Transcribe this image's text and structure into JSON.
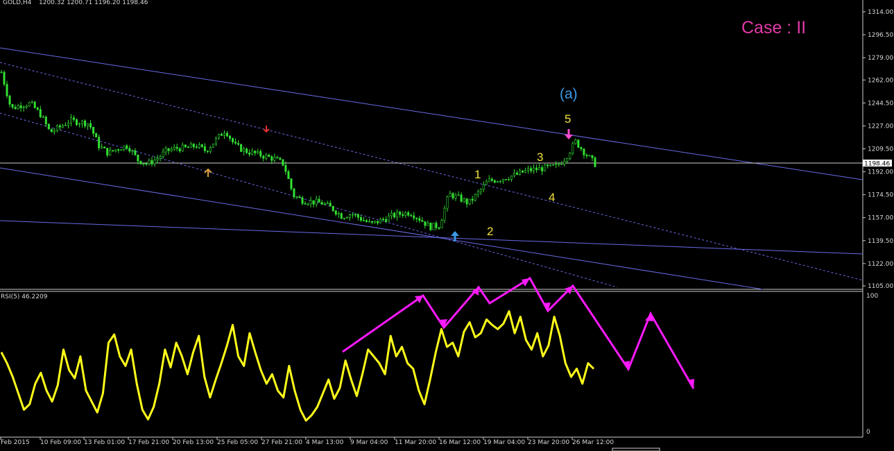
{
  "header": {
    "symbol": "GOLD,H4",
    "ohlc": "1200.32 1200.71 1196.20 1198.46"
  },
  "annotations": {
    "case_label": "Case : II",
    "wave_a": "(a)",
    "wave_numbers": [
      "1",
      "2",
      "3",
      "4",
      "5"
    ]
  },
  "indicator": {
    "label": "RSI(5) 46.2209",
    "max_label": "100",
    "min_label": "0"
  },
  "colors": {
    "background": "#000000",
    "candle": "#33e033",
    "rsi_line": "#ffff1a",
    "channel": "#6a6ae8",
    "projection": "#ff1aff",
    "wave_text": "#f2e23a",
    "case_text": "#e23aa8",
    "wave_a_text": "#3a9ae8"
  },
  "chart_data": [
    {
      "type": "candlestick",
      "symbol": "GOLD",
      "timeframe": "H4",
      "current_price": 1198.46,
      "ylim": [
        1105,
        1314
      ],
      "y_ticks": [
        1314.0,
        1296.5,
        1279.0,
        1262.0,
        1244.5,
        1227.0,
        1209.5,
        1192.0,
        1174.5,
        1157.0,
        1139.5,
        1122.0,
        1105.0
      ],
      "y_tick_labels": [
        "1314.00",
        "1296.50",
        "1279.00",
        "1262.00",
        "1244.50",
        "1227.00",
        "1209.50",
        "1192.00",
        "1174.50",
        "1157.00",
        "1139.50",
        "1122.00",
        "1105.00"
      ],
      "price_label": "1198.46",
      "x_tick_labels": [
        "Feb 2015",
        "10 Feb 09:00",
        "13 Feb 01:00",
        "17 Feb 21:00",
        "20 Feb 13:00",
        "25 Feb 05:00",
        "27 Feb 21:00",
        "4 Mar 13:00",
        "9 Mar 04:00",
        "11 Mar 20:00",
        "16 Mar 12:00",
        "19 Mar 04:00",
        "23 Mar 20:00",
        "26 Mar 12:00"
      ],
      "close_path": [
        1268,
        1240,
        1243,
        1244,
        1236,
        1222,
        1226,
        1231,
        1230,
        1229,
        1212,
        1206,
        1210,
        1212,
        1201,
        1198,
        1202,
        1208,
        1210,
        1210,
        1212,
        1208,
        1216,
        1224,
        1212,
        1208,
        1206,
        1204,
        1202,
        1198,
        1174,
        1170,
        1169,
        1168,
        1164,
        1158,
        1160,
        1156,
        1152,
        1155,
        1158,
        1160,
        1161,
        1156,
        1150,
        1151,
        1175,
        1172,
        1168,
        1176,
        1185,
        1186,
        1188,
        1190,
        1193,
        1194,
        1195,
        1196,
        1203,
        1215,
        1206,
        1198
      ],
      "wave_labels": [
        "1",
        "2",
        "3",
        "4",
        "5"
      ],
      "wave_title": "(a)"
    },
    {
      "type": "line",
      "name": "RSI(5)",
      "ylim": [
        0,
        100
      ],
      "last_value": 46.2209,
      "values": [
        58,
        50,
        40,
        28,
        16,
        20,
        35,
        43,
        30,
        22,
        34,
        60,
        45,
        39,
        55,
        30,
        22,
        14,
        28,
        65,
        71,
        55,
        48,
        60,
        35,
        16,
        9,
        18,
        35,
        60,
        47,
        65,
        55,
        42,
        58,
        70,
        40,
        25,
        38,
        50,
        63,
        78,
        55,
        48,
        72,
        58,
        45,
        35,
        42,
        30,
        25,
        48,
        30,
        16,
        8,
        12,
        18,
        28,
        38,
        24,
        32,
        52,
        38,
        26,
        42,
        60,
        55,
        50,
        42,
        70,
        55,
        62,
        50,
        46,
        30,
        20,
        38,
        58,
        75,
        62,
        65,
        55,
        73,
        80,
        69,
        72,
        82,
        78,
        75,
        79,
        88,
        72,
        84,
        67,
        60,
        72,
        55,
        63,
        84,
        70,
        50,
        40,
        46,
        35,
        50,
        46
      ]
    }
  ]
}
